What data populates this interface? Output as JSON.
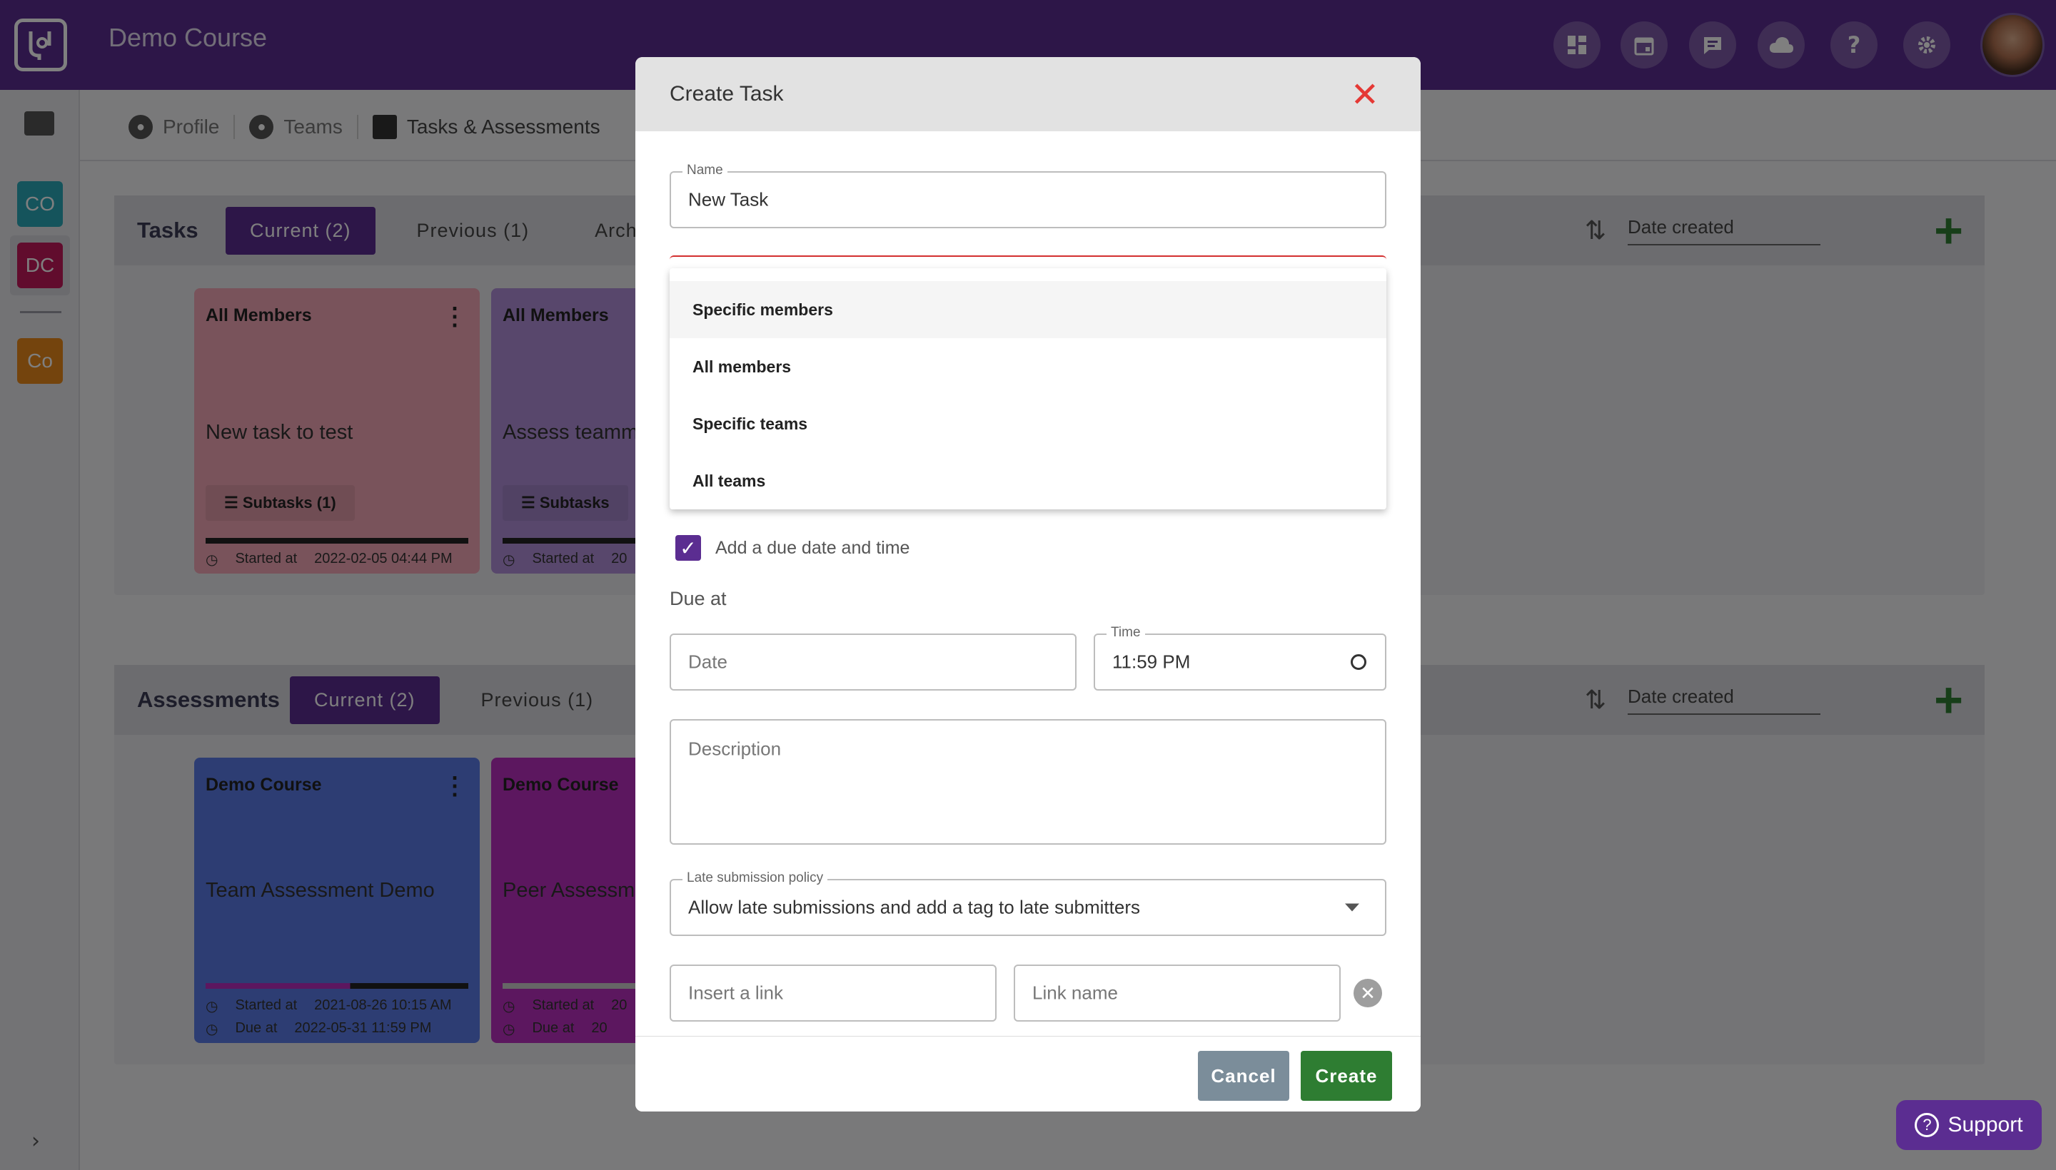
{
  "header": {
    "title": "Demo Course",
    "icons": [
      "dashboard-icon",
      "calendar-icon",
      "chat-icon",
      "cloud-icon",
      "help-icon",
      "settings-icon"
    ]
  },
  "rail": {
    "courses": [
      {
        "label": "CO",
        "color": "#2aa8b8"
      },
      {
        "label": "DC",
        "color": "#c2185b"
      },
      {
        "label": "Co",
        "color": "#e8891a"
      }
    ]
  },
  "breadcrumb": [
    "Profile",
    "Teams",
    "Tasks & Assessments"
  ],
  "tasks": {
    "title": "Tasks",
    "tabs": [
      "Current (2)",
      "Previous (1)",
      "Archive"
    ],
    "sort": "Date created",
    "cards": [
      {
        "assignee": "All Members",
        "name": "New task to test",
        "subtasks": "Subtasks",
        "subtask_count": "(1)",
        "started_label": "Started at",
        "started": "2022-02-05 04:44 PM",
        "color": "#f2a6b6"
      },
      {
        "assignee": "All Members",
        "name": "Assess teamm",
        "subtasks": "Subtasks",
        "started_label": "Started at",
        "started": "20",
        "color": "#b08fd8"
      }
    ]
  },
  "assessments": {
    "title": "Assessments",
    "tabs": [
      "Current (2)",
      "Previous (1)"
    ],
    "sort": "Date created",
    "cards": [
      {
        "course": "Demo Course",
        "name": "Team Assessment Demo",
        "started_label": "Started at",
        "started": "2021-08-26 10:15 AM",
        "due_label": "Due at",
        "due": "2022-05-31 11:59 PM",
        "color": "#5b7be6"
      },
      {
        "course": "Demo Course",
        "name": "Peer Assessm",
        "started_label": "Started at",
        "started": "20",
        "due_label": "Due at",
        "due": "20",
        "color": "#b92fbf"
      }
    ]
  },
  "modal": {
    "title": "Create Task",
    "name_label": "Name",
    "name_value": "New Task",
    "assign_options": [
      "Specific members",
      "All members",
      "Specific teams",
      "All teams"
    ],
    "due_checkbox_label": "Add a due date and time",
    "due_label": "Due at",
    "date_placeholder": "Date",
    "time_label": "Time",
    "time_value": "11:59  PM",
    "description_placeholder": "Description",
    "late_label": "Late submission policy",
    "late_value": "Allow late submissions and add a tag to late submitters",
    "link_placeholder": "Insert a link",
    "link_name_placeholder": "Link name",
    "cancel_label": "Cancel",
    "create_label": "Create"
  },
  "support": {
    "label": "Support"
  }
}
